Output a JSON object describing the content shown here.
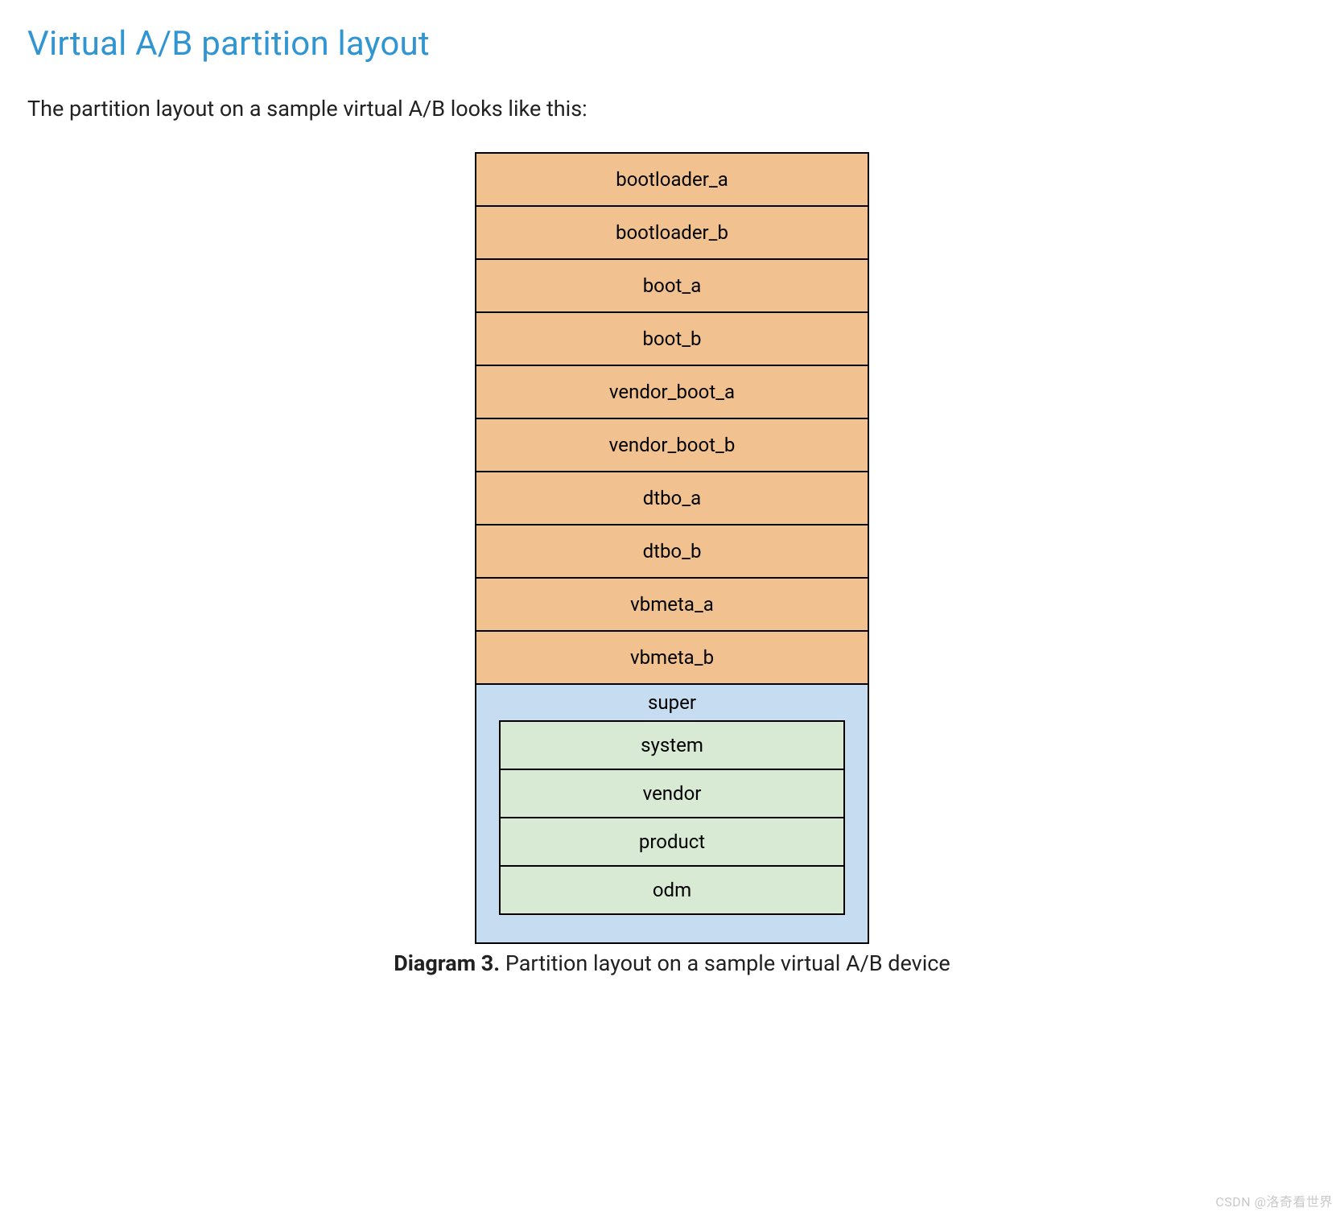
{
  "title": "Virtual A/B partition layout",
  "intro": "The partition layout on a sample virtual A/B looks like this:",
  "outer_partitions": [
    "bootloader_a",
    "bootloader_b",
    "boot_a",
    "boot_b",
    "vendor_boot_a",
    "vendor_boot_b",
    "dtbo_a",
    "dtbo_b",
    "vbmeta_a",
    "vbmeta_b"
  ],
  "super": {
    "label": "super",
    "inner_partitions": [
      "system",
      "vendor",
      "product",
      "odm"
    ]
  },
  "caption": {
    "prefix": "Diagram 3.",
    "text": " Partition layout on a sample virtual A/B device"
  },
  "watermark": "CSDN @洛奇看世界",
  "colors": {
    "title": "#3095d0",
    "outer_bg": "#f1c28f",
    "super_bg": "#c6dcf0",
    "inner_bg": "#d8e9d4",
    "border": "#000000"
  }
}
